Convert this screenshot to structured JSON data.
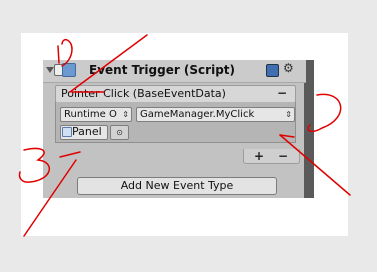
{
  "component": {
    "title": "Event Trigger (Script)",
    "help_icon": "help-book-icon",
    "settings_icon": "gear-icon"
  },
  "event": {
    "title": "Pointer Click (BaseEventData)",
    "remove_label": "−",
    "call_state": "Runtime O",
    "method": "GameManager.MyClick",
    "target_object": "Panel",
    "picker_glyph": "⊙"
  },
  "list_footer": {
    "add_label": "+",
    "remove_label": "−"
  },
  "add_event_button": "Add New Event Type",
  "annotations": {
    "color": "#e00000",
    "labels": [
      "1",
      "2",
      "3"
    ]
  }
}
